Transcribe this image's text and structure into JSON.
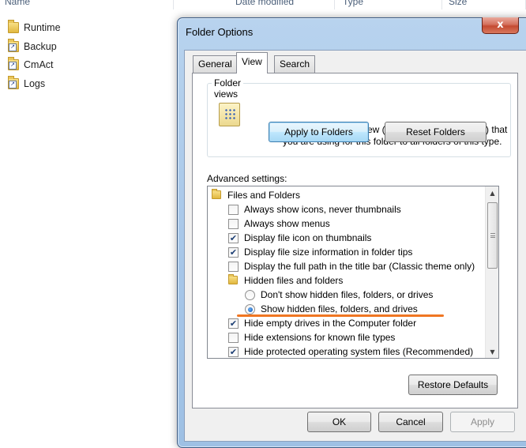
{
  "explorer": {
    "columns": [
      "Name",
      "Date modified",
      "Type",
      "Size"
    ],
    "files": [
      "Runtime",
      "Backup",
      "CmAct",
      "Logs"
    ]
  },
  "dialog": {
    "title": "Folder Options",
    "close_label": "x",
    "tabs": [
      "General",
      "View",
      "Search"
    ],
    "active_tab": "View",
    "folder_views": {
      "title": "Folder views",
      "description": "You can apply the view (such as Details or Icons) that you are using for this folder to all folders of this type.",
      "apply_button": "Apply to Folders",
      "reset_button": "Reset Folders"
    },
    "advanced_label": "Advanced settings:",
    "advanced_items": [
      {
        "type": "folder",
        "label": "Files and Folders"
      },
      {
        "type": "checkbox",
        "checked": false,
        "label": "Always show icons, never thumbnails"
      },
      {
        "type": "checkbox",
        "checked": false,
        "label": "Always show menus"
      },
      {
        "type": "checkbox",
        "checked": true,
        "label": "Display file icon on thumbnails"
      },
      {
        "type": "checkbox",
        "checked": true,
        "label": "Display file size information in folder tips"
      },
      {
        "type": "checkbox",
        "checked": false,
        "label": "Display the full path in the title bar (Classic theme only)"
      },
      {
        "type": "folder",
        "label": "Hidden files and folders"
      },
      {
        "type": "radio",
        "checked": false,
        "label": "Don't show hidden files, folders, or drives"
      },
      {
        "type": "radio",
        "checked": true,
        "label": "Show hidden files, folders, and drives"
      },
      {
        "type": "checkbox",
        "checked": true,
        "label": "Hide empty drives in the Computer folder"
      },
      {
        "type": "checkbox",
        "checked": false,
        "label": "Hide extensions for known file types"
      },
      {
        "type": "checkbox",
        "checked": true,
        "label": "Hide protected operating system files (Recommended)"
      }
    ],
    "restore_button": "Restore Defaults",
    "ok_button": "OK",
    "cancel_button": "Cancel",
    "apply_button": "Apply"
  },
  "colors": {
    "highlight_underline": "#f07622",
    "title_bar": "#a6c6e8",
    "close_button": "#c44a31"
  }
}
